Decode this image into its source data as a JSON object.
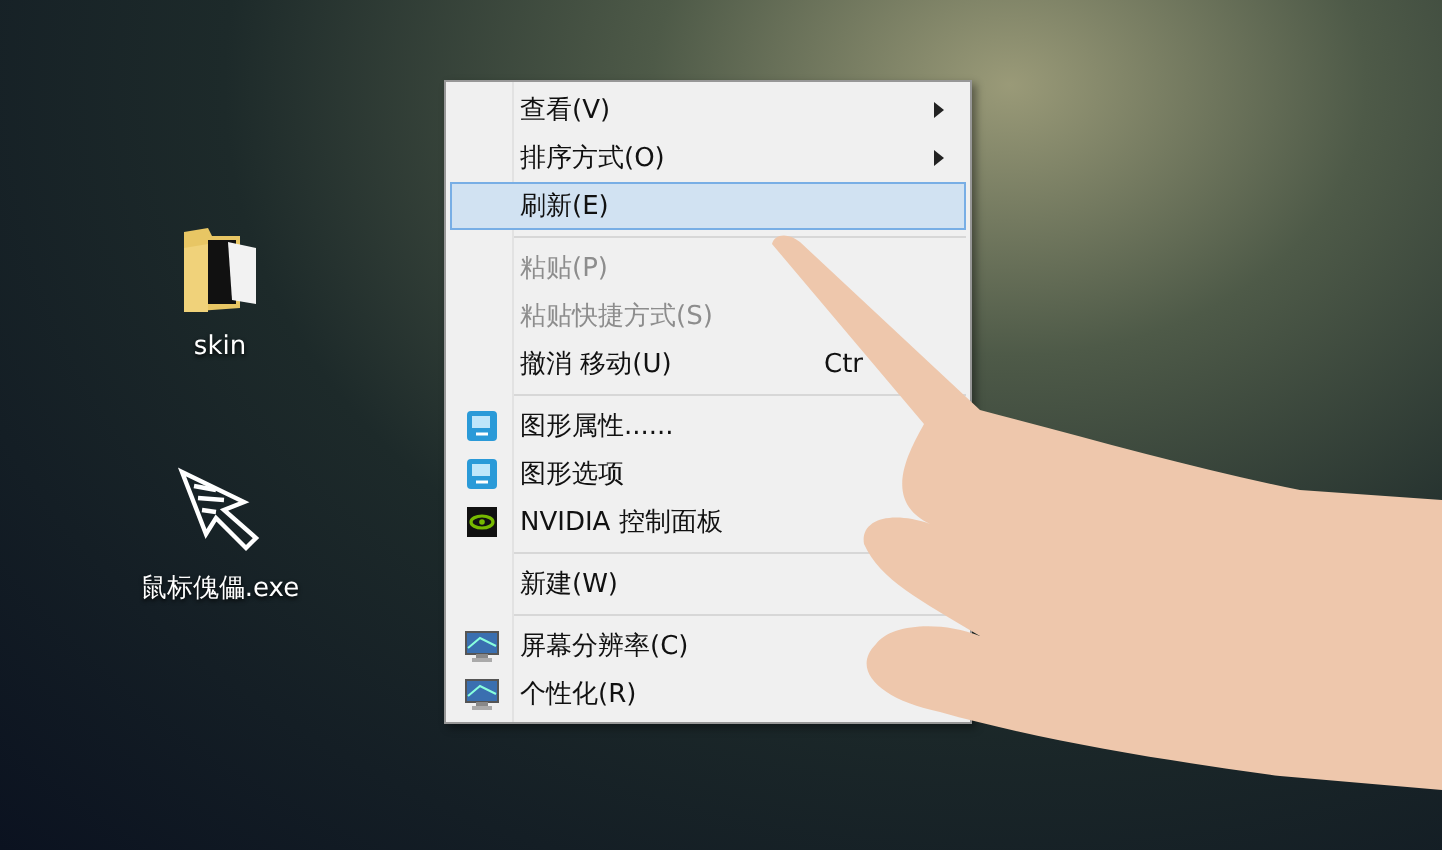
{
  "desktop_icons": [
    {
      "label": "skin"
    },
    {
      "label": "鼠标傀儡.exe"
    }
  ],
  "context_menu": {
    "items": [
      {
        "kind": "item",
        "label": "查看(V)",
        "submenu": true,
        "disabled": false,
        "selected": false
      },
      {
        "kind": "item",
        "label": "排序方式(O)",
        "submenu": true,
        "disabled": false,
        "selected": false
      },
      {
        "kind": "item",
        "label": "刷新(E)",
        "submenu": false,
        "disabled": false,
        "selected": true
      },
      {
        "kind": "separator"
      },
      {
        "kind": "item",
        "label": "粘贴(P)",
        "submenu": false,
        "disabled": true,
        "selected": false
      },
      {
        "kind": "item",
        "label": "粘贴快捷方式(S)",
        "submenu": false,
        "disabled": true,
        "selected": false
      },
      {
        "kind": "item",
        "label": "撤消 移动(U)",
        "shortcut": "Ctr",
        "submenu": false,
        "disabled": false,
        "selected": false
      },
      {
        "kind": "separator"
      },
      {
        "kind": "graphics",
        "label": "图形属性......",
        "submenu": false,
        "disabled": false,
        "selected": false
      },
      {
        "kind": "graphics",
        "label": "图形选项",
        "submenu": false,
        "disabled": false,
        "selected": false
      },
      {
        "kind": "nvidia",
        "label": "NVIDIA 控制面板",
        "submenu": false,
        "disabled": false,
        "selected": false
      },
      {
        "kind": "separator"
      },
      {
        "kind": "item",
        "label": "新建(W)",
        "submenu": false,
        "disabled": false,
        "selected": false
      },
      {
        "kind": "separator"
      },
      {
        "kind": "display",
        "label": "屏幕分辨率(C)",
        "submenu": false,
        "disabled": false,
        "selected": false
      },
      {
        "kind": "display",
        "label": "个性化(R)",
        "submenu": false,
        "disabled": false,
        "selected": false
      }
    ]
  }
}
